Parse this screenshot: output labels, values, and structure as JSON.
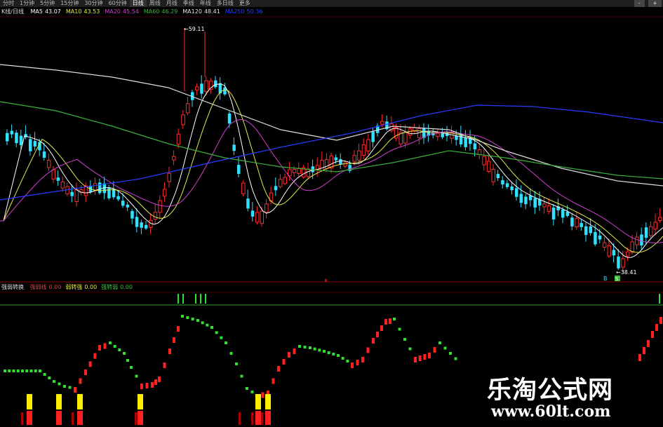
{
  "toolbar": {
    "tabs": [
      "分时",
      "1分钟",
      "5分钟",
      "15分钟",
      "30分钟",
      "60分钟",
      "日线",
      "周线",
      "月线",
      "季线",
      "年线",
      "多日线",
      "更多"
    ],
    "active_tab_index": 6,
    "right_buttons": [
      "-",
      "+"
    ]
  },
  "main_panel": {
    "indicator_label": "K线/日线",
    "ma_legend": [
      {
        "label": "MA5",
        "value": "43.07",
        "color": "#ffffff"
      },
      {
        "label": "MA10",
        "value": "43.53",
        "color": "#e8e84a"
      },
      {
        "label": "MA20",
        "value": "45.54",
        "color": "#d040d0"
      },
      {
        "label": "MA60",
        "value": "46.29",
        "color": "#40b040"
      },
      {
        "label": "MA120",
        "value": "48.41",
        "color": "#e0e0e0"
      },
      {
        "label": "MA250",
        "value": "50.36",
        "color": "#2a3cff"
      }
    ],
    "high_label": "59.11",
    "low_label": "38.41",
    "badges": [
      "B",
      "S"
    ]
  },
  "sub_panel": {
    "indicator_label": "强弱转换",
    "params": [
      {
        "label": "强弱线",
        "value": "0.00",
        "color": "#e04040"
      },
      {
        "label": "弱转强",
        "value": "0.00",
        "color": "#e8e84a"
      },
      {
        "label": "强转弱",
        "value": "0.00",
        "color": "#40c040"
      }
    ]
  },
  "watermark": {
    "title": "乐淘公式网",
    "url": "www.60lt.com"
  },
  "colors": {
    "up": "#ff2a2a",
    "down": "#30e0ff",
    "osc_up": "#ff2020",
    "osc_down": "#30e030",
    "signal_yellow": "#ffee00"
  }
}
